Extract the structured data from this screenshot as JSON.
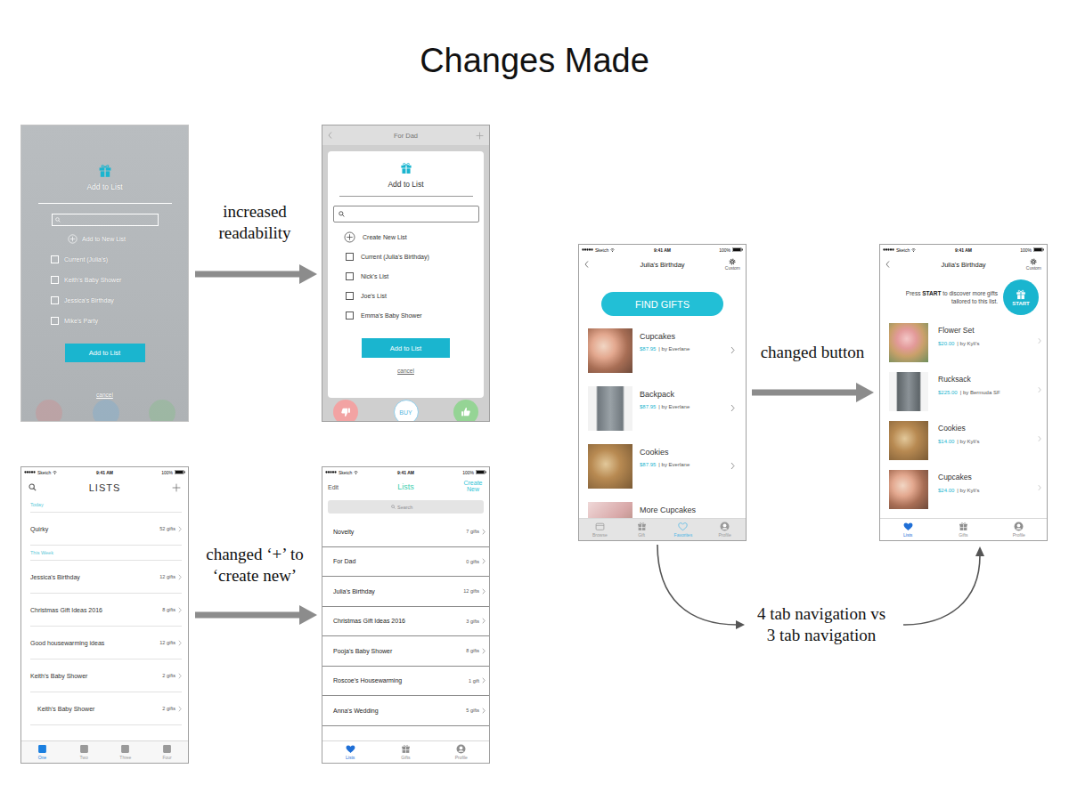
{
  "title": "Changes Made",
  "annotations": [
    {
      "lines": [
        "increased",
        "readability"
      ]
    },
    {
      "lines": [
        "changed ‘+’ to",
        "‘create new’"
      ]
    },
    {
      "lines": [
        "changed button"
      ]
    },
    {
      "lines": [
        "4 tab navigation vs",
        "3 tab navigation"
      ]
    }
  ],
  "screens": [
    {
      "kind": "add-to-list-old",
      "heading": "Add to List",
      "new_list": "Add to New List",
      "lists": [
        {
          "label": "Current (Julia's)",
          "checked": false
        },
        {
          "label": "Keith's Baby Shower",
          "checked": false
        },
        {
          "label": "Jessica's Birthday",
          "checked": false
        },
        {
          "label": "Mike's Party",
          "checked": false
        }
      ],
      "button": "Add to List",
      "cancel": "cancel"
    },
    {
      "kind": "add-to-list-new",
      "nav_title": "For Dad",
      "heading": "Add to List",
      "new_list": "Create New List",
      "lists": [
        {
          "label": "Current (Julia's Birthday)",
          "checked": false
        },
        {
          "label": "Nick's List",
          "checked": false
        },
        {
          "label": "Joe's List",
          "checked": false
        },
        {
          "label": "Emma's Baby Shower",
          "checked": false
        }
      ],
      "button": "Add to List",
      "cancel": "cancel",
      "actions": [
        {
          "kind": "dislike"
        },
        {
          "kind": "buy",
          "label": "BUY"
        },
        {
          "kind": "like"
        }
      ]
    },
    {
      "kind": "lists-old",
      "status": {
        "carrier": "Sketch",
        "time": "9:41 AM",
        "battery": "100%"
      },
      "nav_title": "LISTS",
      "items": [
        {
          "kind": "section",
          "label": "Today"
        },
        {
          "kind": "row",
          "label": "Quirky",
          "count": "52 gifts",
          "indented": false
        },
        {
          "kind": "section",
          "label": "This Week"
        },
        {
          "kind": "row",
          "label": "Jessica's Birthday",
          "count": "12 gifts",
          "indented": false
        },
        {
          "kind": "row",
          "label": "Christmas Gift Ideas 2016",
          "count": "8 gifts",
          "indented": false
        },
        {
          "kind": "row",
          "label": "Good housewarming ideas",
          "count": "12 gifts",
          "indented": false
        },
        {
          "kind": "row",
          "label": "Keith's Baby Shower",
          "count": "2 gifts",
          "indented": false
        },
        {
          "kind": "row",
          "label": "Keith's Baby Shower",
          "count": "2 gifts",
          "indented": true
        }
      ],
      "tabs": [
        {
          "label": "One",
          "kind": "square",
          "selected": true
        },
        {
          "label": "Two",
          "kind": "square",
          "selected": false
        },
        {
          "label": "Three",
          "kind": "square",
          "selected": false
        },
        {
          "label": "Four",
          "kind": "square",
          "selected": false
        }
      ]
    },
    {
      "kind": "lists-new",
      "status": {
        "carrier": "Sketch",
        "time": "9:41 AM",
        "battery": "100%"
      },
      "nav_left": "Edit",
      "nav_title": "Lists",
      "nav_right": "Create New",
      "search": {
        "placeholder": "Search"
      },
      "items": [
        {
          "label": "Novelty",
          "count": "7 gifts"
        },
        {
          "label": "For Dad",
          "count": "0 gifts"
        },
        {
          "label": "Julia's Birthday",
          "count": "12 gifts"
        },
        {
          "label": "Christmas Gift Ideas 2016",
          "count": "3 gifts"
        },
        {
          "label": "Pooja's Baby Shower",
          "count": "8 gifts"
        },
        {
          "label": "Roscoe's Housewarming",
          "count": "1 gift"
        },
        {
          "label": "Anna's Wedding",
          "count": "5 gifts"
        }
      ],
      "tabs": [
        {
          "label": "Lists",
          "kind": "heart",
          "selected": true
        },
        {
          "label": "Gifts",
          "kind": "gift",
          "selected": false
        },
        {
          "label": "Profile",
          "kind": "profile",
          "selected": false
        }
      ]
    },
    {
      "kind": "gifts-old",
      "status": {
        "carrier": "Sketch",
        "time": "9:41 AM",
        "battery": "100%"
      },
      "nav_title": "Julia's Birthday",
      "nav_right": "Custom",
      "button": "FIND GIFTS",
      "items": [
        {
          "name": "Cupcakes",
          "price": "$87.95",
          "by": "| by Everlane"
        },
        {
          "name": "Backpack",
          "price": "$87.95",
          "by": "| by Everlane"
        },
        {
          "name": "Cookies",
          "price": "$87.95",
          "by": "| by Everlane"
        },
        {
          "name": "More Cupcakes"
        }
      ],
      "tabs": [
        {
          "label": "Browse",
          "kind": "browse",
          "selected": false
        },
        {
          "label": "Gift",
          "kind": "gift",
          "selected": false
        },
        {
          "label": "Favorites",
          "kind": "heart",
          "selected": true
        },
        {
          "label": "Profile",
          "kind": "profile",
          "selected": false
        }
      ]
    },
    {
      "kind": "gifts-new",
      "status": {
        "carrier": "Sketch",
        "time": "9:41 AM",
        "battery": "100%"
      },
      "nav_title": "Julia's Birthday",
      "nav_right": "Custom",
      "hint": [
        {
          "text": "Press ",
          "bold": false
        },
        {
          "text": "START",
          "bold": true
        },
        {
          "text": " to discover more gifts tailored to this list.",
          "bold": false
        }
      ],
      "start_button": "START",
      "items": [
        {
          "name": "Flower Set",
          "price": "$20.00",
          "by": "| by Kyli's"
        },
        {
          "name": "Rucksack",
          "price": "$225.00",
          "by": "| by Bermuda SF"
        },
        {
          "name": "Cookies",
          "price": "$14.00",
          "by": "| by Kyli's"
        },
        {
          "name": "Cupcakes",
          "price": "$24.00",
          "by": "| by Kyli's"
        }
      ],
      "tabs": [
        {
          "label": "Lists",
          "kind": "heart",
          "selected": true
        },
        {
          "label": "Gifts",
          "kind": "gift",
          "selected": false
        },
        {
          "label": "Profile",
          "kind": "profile",
          "selected": false
        }
      ]
    }
  ]
}
